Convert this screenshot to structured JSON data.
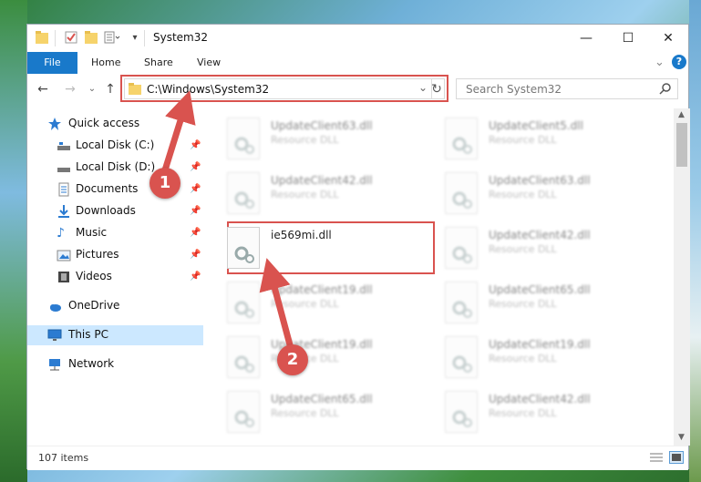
{
  "window": {
    "title": "System32",
    "controls": {
      "minimize": "—",
      "maximize": "☐",
      "close": "✕"
    }
  },
  "ribbon": {
    "tabs": [
      "File",
      "Home",
      "Share",
      "View"
    ],
    "expand_icon": "⌄",
    "help_icon": "?"
  },
  "address_bar": {
    "path": "C:\\Windows\\System32",
    "dropdown_icon": "⌄",
    "refresh_icon": "↻"
  },
  "search": {
    "placeholder": "Search System32"
  },
  "sidebar": {
    "items": [
      {
        "label": "Quick access",
        "icon": "star-icon",
        "pinned": false
      },
      {
        "label": "Local Disk (C:)",
        "icon": "drive-icon",
        "pinned": true
      },
      {
        "label": "Local Disk (D:)",
        "icon": "drive-icon",
        "pinned": true
      },
      {
        "label": "Documents",
        "icon": "document-icon",
        "pinned": true
      },
      {
        "label": "Downloads",
        "icon": "download-icon",
        "pinned": true
      },
      {
        "label": "Music",
        "icon": "music-icon",
        "pinned": true
      },
      {
        "label": "Pictures",
        "icon": "pictures-icon",
        "pinned": true
      },
      {
        "label": "Videos",
        "icon": "videos-icon",
        "pinned": true
      },
      {
        "label": "OneDrive",
        "icon": "cloud-icon",
        "pinned": false
      },
      {
        "label": "This PC",
        "icon": "computer-icon",
        "pinned": false,
        "selected": true
      },
      {
        "label": "Network",
        "icon": "network-icon",
        "pinned": false
      }
    ]
  },
  "files": [
    {
      "name": "UpdateClient63.dll",
      "type": "Resource DLL",
      "blurred": true
    },
    {
      "name": "UpdateClient5.dll",
      "type": "Resource DLL",
      "blurred": true
    },
    {
      "name": "UpdateClient42.dll",
      "type": "Resource DLL",
      "blurred": true
    },
    {
      "name": "UpdateClient63.dll",
      "type": "Resource DLL",
      "blurred": true
    },
    {
      "name": "ie569mi.dll",
      "type": "",
      "blurred": false,
      "highlighted": true
    },
    {
      "name": "UpdateClient42.dll",
      "type": "Resource DLL",
      "blurred": true
    },
    {
      "name": "UpdateClient19.dll",
      "type": "Resource DLL",
      "blurred": true
    },
    {
      "name": "UpdateClient65.dll",
      "type": "Resource DLL",
      "blurred": true
    },
    {
      "name": "UpdateClient19.dll",
      "type": "Resource DLL",
      "blurred": true
    },
    {
      "name": "UpdateClient19.dll",
      "type": "Resource DLL",
      "blurred": true
    },
    {
      "name": "UpdateClient65.dll",
      "type": "Resource DLL",
      "blurred": true
    },
    {
      "name": "UpdateClient42.dll",
      "type": "Resource DLL",
      "blurred": true
    }
  ],
  "status": {
    "items_count": "107 items"
  },
  "annotations": {
    "badge1": "1",
    "badge2": "2"
  },
  "colors": {
    "accent": "#1979ca",
    "highlight": "#d9534f"
  }
}
